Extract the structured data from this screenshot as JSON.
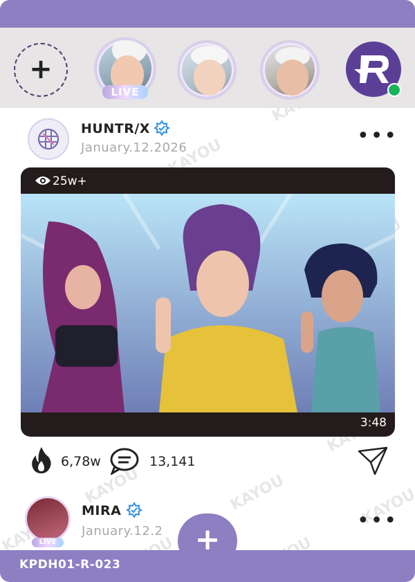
{
  "stories": {
    "add_label": "+",
    "live_label": "LIVE"
  },
  "post": {
    "username": "HUNTR/X",
    "date": "January.12.2026",
    "more_label": "•••",
    "views": "25w+",
    "duration": "3:48",
    "likes": "6,78w",
    "comments": "13,141"
  },
  "next_post": {
    "username": "MIRA",
    "date": "January.12.2",
    "live_label": "LIVE",
    "more_label": "•••"
  },
  "fab": {
    "label": "+"
  },
  "footer": {
    "code": "KPDH01-R-023"
  },
  "watermark": "KAYOU",
  "colors": {
    "accent": "#8d7fc2",
    "verified": "#2f8fe0",
    "online": "#19b35a"
  },
  "icons": [
    "plus-icon",
    "eye-icon",
    "fire-icon",
    "comment-icon",
    "send-icon",
    "verified-icon",
    "more-icon"
  ]
}
